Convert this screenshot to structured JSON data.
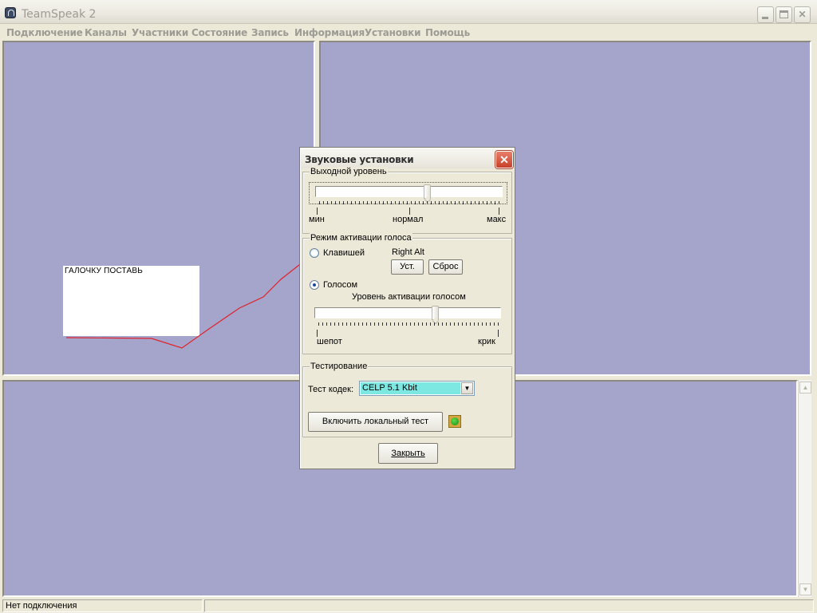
{
  "window": {
    "title": "TeamSpeak 2"
  },
  "menu": {
    "items": [
      "Подключение",
      "Каналы",
      "Участники",
      "Состояние",
      "Запись",
      "Информация",
      "Установки",
      "Помощь"
    ]
  },
  "annotation": {
    "text": "ГАЛОЧКУ  ПОСТАВЬ"
  },
  "dialog": {
    "title": "Звуковые установки",
    "output_group": {
      "label": "Выходной уровень",
      "min_label": "мин",
      "mid_label": "нормал",
      "max_label": "макс",
      "slider_value": 0.6
    },
    "voice_group": {
      "label": "Режим активации голоса",
      "key_radio_label": "Клавишей",
      "key_radio_checked": false,
      "hotkey": "Right Alt",
      "set_button": "Уст.",
      "reset_button": "Сброс",
      "voice_radio_label": "Голосом",
      "voice_radio_checked": true,
      "activation_label": "Уровень активации голосом",
      "whisper_label": "шепот",
      "shout_label": "крик",
      "slider_value": 0.65
    },
    "test_group": {
      "label": "Тестирование",
      "codec_label": "Тест кодек:",
      "codec_value": "CELP 5.1 Kbit",
      "local_test_button": "Включить локальный тест",
      "led_color": "#2fae25"
    },
    "close_button": "Закрыть"
  },
  "statusbar": {
    "status": "Нет подключения"
  },
  "colors": {
    "pane_bg": "#a5a5cc",
    "annotation_line": "#e0202a"
  }
}
